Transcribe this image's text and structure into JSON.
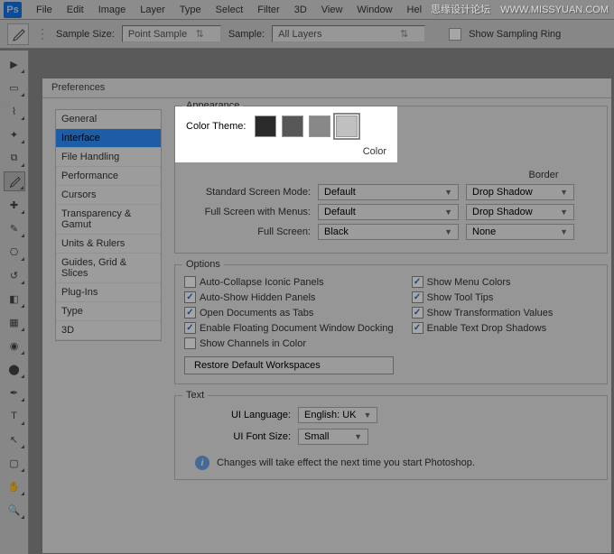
{
  "watermark": {
    "a": "思缘设计论坛",
    "b": "WWW.MISSYUAN.COM"
  },
  "menubar": {
    "logo": "Ps",
    "items": [
      "File",
      "Edit",
      "Image",
      "Layer",
      "Type",
      "Select",
      "Filter",
      "3D",
      "View",
      "Window",
      "Hel"
    ]
  },
  "optionsbar": {
    "sample_size_label": "Sample Size:",
    "sample_size_value": "Point Sample",
    "sample_label": "Sample:",
    "sample_value": "All Layers",
    "show_ring": "Show Sampling Ring"
  },
  "pref": {
    "title": "Preferences",
    "categories": [
      "General",
      "Interface",
      "File Handling",
      "Performance",
      "Cursors",
      "Transparency & Gamut",
      "Units & Rulers",
      "Guides, Grid & Slices",
      "Plug-Ins",
      "Type",
      "3D"
    ],
    "selected_index": 1,
    "appearance": {
      "legend": "Appearance",
      "color_theme_label": "Color Theme:",
      "swatch_colors": [
        "#2a2a2a",
        "#575757",
        "#888888",
        "#c0c0c0"
      ],
      "selected_swatch": 3,
      "col_color": "Color",
      "col_border": "Border",
      "rows": [
        {
          "label": "Standard Screen Mode:",
          "color": "Default",
          "border": "Drop Shadow"
        },
        {
          "label": "Full Screen with Menus:",
          "color": "Default",
          "border": "Drop Shadow"
        },
        {
          "label": "Full Screen:",
          "color": "Black",
          "border": "None"
        }
      ]
    },
    "options": {
      "legend": "Options",
      "left": [
        {
          "checked": false,
          "label": "Auto-Collapse Iconic Panels"
        },
        {
          "checked": true,
          "label": "Auto-Show Hidden Panels"
        },
        {
          "checked": true,
          "label": "Open Documents as Tabs"
        },
        {
          "checked": true,
          "label": "Enable Floating Document Window Docking"
        },
        {
          "checked": false,
          "label": "Show Channels in Color"
        }
      ],
      "right": [
        {
          "checked": true,
          "label": "Show Menu Colors"
        },
        {
          "checked": true,
          "label": "Show Tool Tips"
        },
        {
          "checked": true,
          "label": "Show Transformation Values"
        },
        {
          "checked": true,
          "label": "Enable Text Drop Shadows"
        }
      ],
      "restore_btn": "Restore Default Workspaces"
    },
    "text": {
      "legend": "Text",
      "ui_lang_label": "UI Language:",
      "ui_lang_value": "English: UK",
      "ui_font_label": "UI Font Size:",
      "ui_font_value": "Small",
      "info": "Changes will take effect the next time you start Photoshop."
    }
  }
}
